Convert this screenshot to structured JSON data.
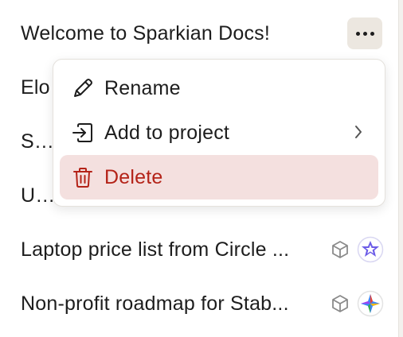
{
  "documents": [
    {
      "title": "Welcome to Sparkian Docs!"
    },
    {
      "title": "Elo"
    },
    {
      "title": "Say"
    },
    {
      "title": "Urg"
    },
    {
      "title": "Laptop price list from Circle ..."
    },
    {
      "title": "Non-profit roadmap for Stab..."
    }
  ],
  "context_menu": {
    "rename_label": "Rename",
    "add_to_project_label": "Add to project",
    "delete_label": "Delete"
  },
  "colors": {
    "delete_text": "#b42318",
    "delete_background": "#f4e0df",
    "more_button_background": "#ece7e0"
  },
  "icons": {
    "more": "ellipsis-icon",
    "rename": "pencil-icon",
    "add_to_project": "arrow-into-box-icon",
    "submenu": "chevron-right-icon",
    "delete": "trash-icon",
    "row_type": "cube-icon",
    "row_app_a": "purple-star-badge-icon",
    "row_app_b": "sparkle-gem-icon"
  }
}
